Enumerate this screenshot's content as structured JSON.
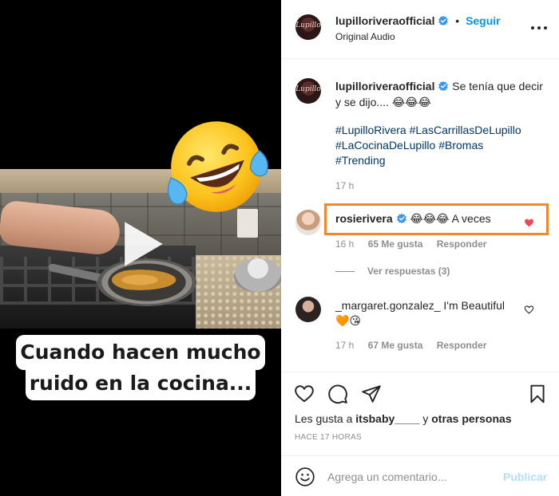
{
  "video": {
    "caption_line1": "Cuando hacen mucho",
    "caption_line2": "ruido en la cocina..."
  },
  "header": {
    "username": "lupillorivera­official",
    "follow_label": "Seguir",
    "dot": "•",
    "audio": "Original Audio",
    "avatar_text": "Lupillo"
  },
  "caption": {
    "username": "lupillorivera­official",
    "text": "Se tenía que decir y se dijo....",
    "emojis": "😂😂😂",
    "hashtags": [
      "#LupilloRivera",
      "#LasCarrillasDeLupillo",
      "#LaCocinaDeLupillo",
      "#Bromas",
      "#Trending"
    ],
    "time": "17 h"
  },
  "comments": [
    {
      "username": "rosierivera",
      "emojis": "😂😂😂",
      "text": "A veces",
      "time": "16 h",
      "likes": "65 Me gusta",
      "reply_label": "Responder",
      "liked": true
    },
    {
      "username": "_margaret.gonzalez_",
      "text": "I'm Beautiful",
      "emojis": "🧡😘",
      "time": "17 h",
      "likes": "67 Me gusta",
      "reply_label": "Responder",
      "liked": false
    }
  ],
  "view_replies": "Ver respuestas (3)",
  "likes": {
    "prefix": "Les gusta a",
    "user": "itsbaby____",
    "middle": "y",
    "suffix": "otras personas"
  },
  "ago": "HACE 17 HORAS",
  "comment_box": {
    "placeholder": "Agrega un comentario...",
    "publish_label": "Publicar"
  },
  "colors": {
    "accent": "#0095f6",
    "highlight": "#f0892d",
    "heart": "#ed4956",
    "link": "#00376b",
    "muted": "#8e8e8e"
  }
}
